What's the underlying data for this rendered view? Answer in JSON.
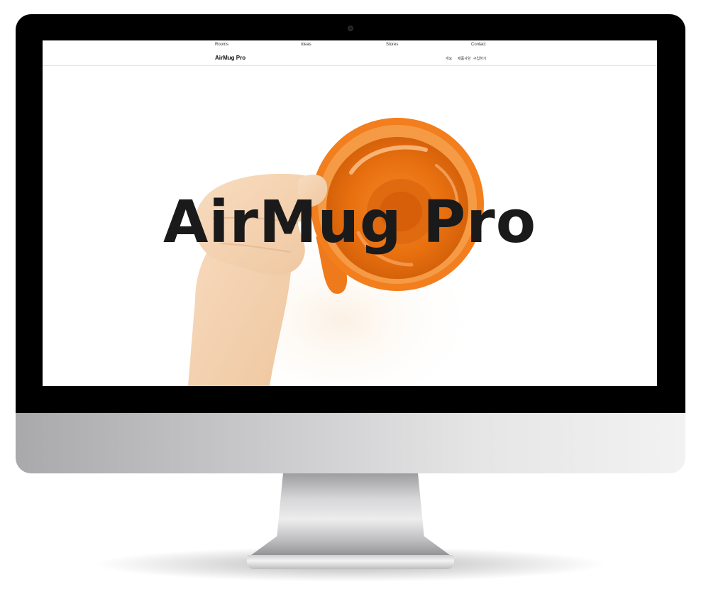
{
  "global_nav": {
    "items": [
      "Rooms",
      "Ideas",
      "Stores",
      "Contact"
    ]
  },
  "product_nav": {
    "title": "AirMug Pro",
    "links": [
      "개요",
      "제품사양",
      "구입하기"
    ]
  },
  "hero": {
    "title": "AirMug Pro"
  },
  "colors": {
    "mug_orange": "#f07a1a",
    "mug_inner": "#e86a0e",
    "hand_skin": "#f4d2b0",
    "bezel": "#000000",
    "text_dark": "#1a1a1a"
  }
}
